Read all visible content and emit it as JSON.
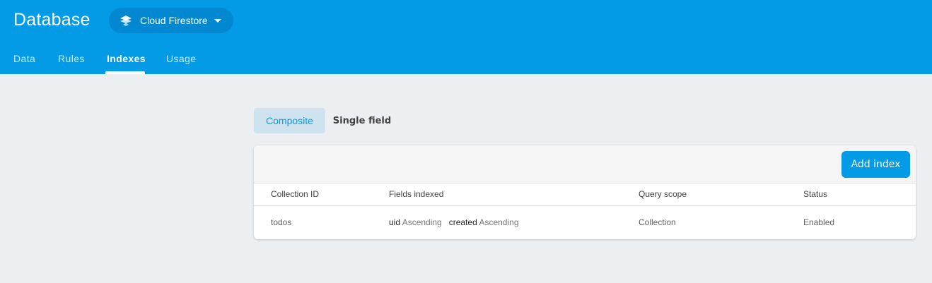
{
  "header": {
    "title": "Database",
    "db_selector": {
      "label": "Cloud Firestore",
      "icon": "firestore-icon"
    },
    "tabs": [
      {
        "label": "Data"
      },
      {
        "label": "Rules"
      },
      {
        "label": "Indexes",
        "active": true
      },
      {
        "label": "Usage"
      }
    ]
  },
  "subtabs": [
    {
      "label": "Composite",
      "active": true
    },
    {
      "label": "Single field",
      "active": false
    }
  ],
  "card": {
    "add_button_label": "Add index",
    "columns": [
      "Collection ID",
      "Fields indexed",
      "Query scope",
      "Status"
    ],
    "rows": [
      {
        "collection_id": "todos",
        "fields": [
          {
            "name": "uid",
            "order": "Ascending"
          },
          {
            "name": "created",
            "order": "Ascending"
          }
        ],
        "query_scope": "Collection",
        "status": "Enabled"
      }
    ]
  },
  "colors": {
    "header_bg": "#039be5",
    "selector_bg": "#0288d1",
    "page_bg": "#eceff1",
    "accent": "#039be5"
  }
}
